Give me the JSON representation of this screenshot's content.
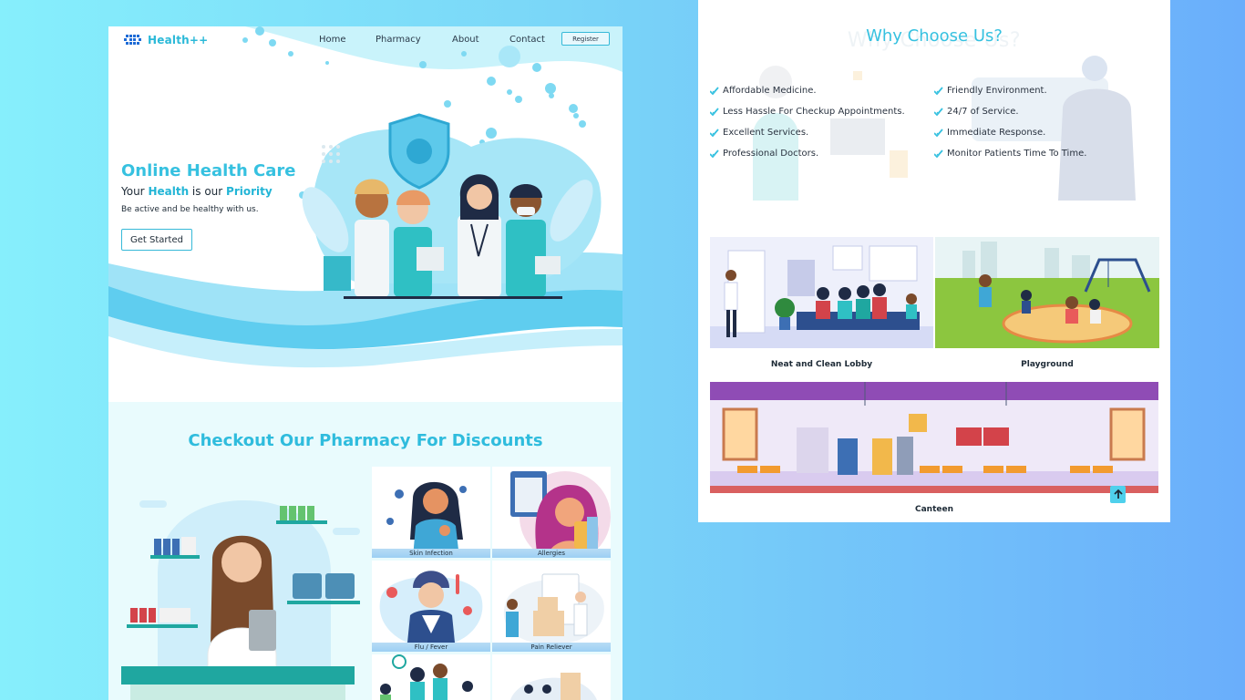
{
  "nav": {
    "logo_text": "Health++",
    "links": [
      "Home",
      "Pharmacy",
      "About",
      "Contact"
    ],
    "register_label": "Register"
  },
  "hero": {
    "title": "Online Health Care",
    "subtitle_parts": [
      "Your ",
      "Health",
      " is our ",
      "Priority"
    ],
    "description": "Be active and be healthy with us.",
    "cta_label": "Get Started"
  },
  "pharmacy": {
    "title": "Checkout Our Pharmacy For Discounts",
    "cards": [
      {
        "label": "Skin Infection"
      },
      {
        "label": "Allergies"
      },
      {
        "label": "Flu / Fever"
      },
      {
        "label": "Pain Reliever"
      },
      {
        "label": ""
      },
      {
        "label": ""
      }
    ]
  },
  "why": {
    "title": "Why Choose Us?",
    "features_left": [
      "Affordable Medicine.",
      "Less Hassle For Checkup Appointments.",
      "Excellent Services.",
      "Professional Doctors."
    ],
    "features_right": [
      "Friendly Environment.",
      "24/7 of Service.",
      "Immediate Response.",
      "Monitor Patients Time To Time."
    ]
  },
  "facilities": [
    {
      "label": "Neat and Clean Lobby"
    },
    {
      "label": "Playground"
    },
    {
      "label": "Canteen"
    }
  ],
  "icons": [
    "logo-icon",
    "check-icon",
    "arrow-up-icon"
  ],
  "colors": {
    "accent": "#36c1e0",
    "accent_dark": "#22b5d6",
    "background_left": "#86effc",
    "background_right": "#6aaefb"
  }
}
